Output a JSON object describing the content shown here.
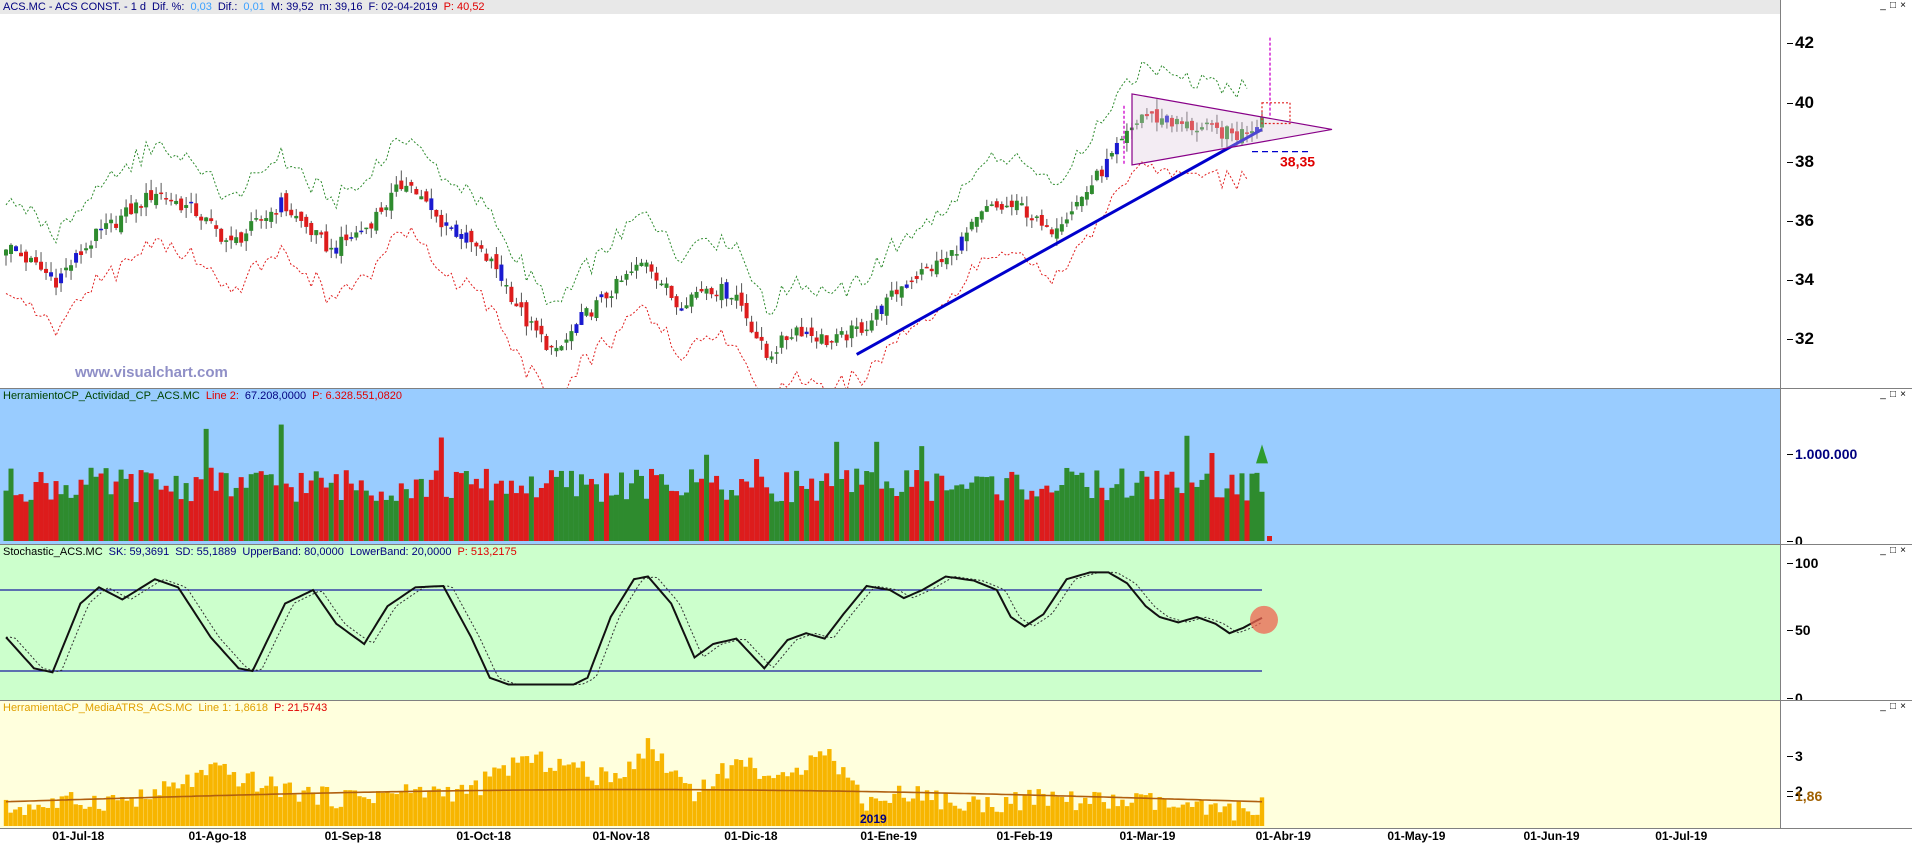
{
  "panes": {
    "price": {
      "header": [
        {
          "text": "ACS.MC - ACS CONST. -  1 d",
          "color": "#000080"
        },
        {
          "text": "Dif. %:",
          "color": "#000080"
        },
        {
          "text": "0,03",
          "color": "#3aa0ff"
        },
        {
          "text": "Dif.:",
          "color": "#000080"
        },
        {
          "text": "0,01",
          "color": "#3aa0ff"
        },
        {
          "text": "M: 39,52",
          "color": "#000080"
        },
        {
          "text": "m: 39,16",
          "color": "#000080"
        },
        {
          "text": "F: 02-04-2019",
          "color": "#000080"
        },
        {
          "text": "P: 40,52",
          "color": "#e00000"
        }
      ],
      "yticks": [
        "42",
        "40",
        "38",
        "36",
        "34",
        "32"
      ],
      "annotation": "38,35",
      "watermark": "www.visualchart.com"
    },
    "volume": {
      "header": [
        {
          "text": "HerramientoCP_Actividad_CP_ACS.MC",
          "color": "#004400"
        },
        {
          "text": "Line 2:",
          "color": "#e00000"
        },
        {
          "text": "67.208,0000",
          "color": "#000080"
        },
        {
          "text": "P: 6.328.551,0820",
          "color": "#e00000"
        }
      ],
      "yticks": [
        "1.000.000",
        "0"
      ]
    },
    "stochastic": {
      "header": [
        {
          "text": "Stochastic_ACS.MC",
          "color": "#000000"
        },
        {
          "text": "SK: 59,3691",
          "color": "#000080"
        },
        {
          "text": "SD: 55,1889",
          "color": "#000080"
        },
        {
          "text": "UpperBand: 80,0000",
          "color": "#000080"
        },
        {
          "text": "LowerBand: 20,0000",
          "color": "#000080"
        },
        {
          "text": "P: 513,2175",
          "color": "#e00000"
        }
      ],
      "yticks": [
        "100",
        "50",
        "0"
      ]
    },
    "atr": {
      "header": [
        {
          "text": "HerramientaCP_MediaATRS_ACS.MC",
          "color": "#e0a000"
        },
        {
          "text": "Line 1: 1,8618",
          "color": "#e0a000"
        },
        {
          "text": "P: 21,5743",
          "color": "#e00000"
        }
      ],
      "yticks": [
        "3",
        "2",
        "1,86"
      ],
      "year_label": "2019"
    }
  },
  "x_axis": {
    "labels": [
      "01-Jul-18",
      "01-Ago-18",
      "01-Sep-18",
      "01-Oct-18",
      "01-Nov-18",
      "01-Dic-18",
      "01-Ene-19",
      "01-Feb-19",
      "01-Mar-19",
      "01-Abr-19",
      "01-May-19",
      "01-Jun-19",
      "01-Jul-19"
    ]
  },
  "window_controls": [
    "_",
    "□",
    "×"
  ],
  "colors": {
    "up": "#2e8b2e",
    "down": "#dd1c1c",
    "neutral": "#1a1ad0",
    "volume_bg": "#99ccff",
    "stoch_bg": "#ccffcc",
    "atr_bg": "#ffffdd",
    "atr_bar": "#f7b500",
    "trendline": "#0000cc",
    "triangle": "#880088"
  },
  "chart_data": [
    {
      "type": "candlestick",
      "title": "ACS.MC - ACS CONST. - 1 d",
      "ylim": [
        30.5,
        43
      ],
      "x_start": "2018-06-20",
      "x_end": "2019-04-02",
      "trend_start": 31.5,
      "trend_end": 39.1,
      "channel_offset": 1.4,
      "triangle": {
        "top_left": 40.3,
        "bottom_left": 37.9,
        "apex": 39.1,
        "upper_right": 39.5
      },
      "target": 38.35,
      "close": 39.52,
      "anchors": [
        [
          0,
          35.2
        ],
        [
          10,
          34.0
        ],
        [
          18,
          35.5
        ],
        [
          30,
          37.0
        ],
        [
          38,
          36.3
        ],
        [
          45,
          35.2
        ],
        [
          55,
          36.6
        ],
        [
          65,
          35.0
        ],
        [
          72,
          35.8
        ],
        [
          80,
          37.4
        ],
        [
          86,
          36.1
        ],
        [
          92,
          35.4
        ],
        [
          98,
          34.4
        ],
        [
          104,
          32.6
        ],
        [
          110,
          31.5
        ],
        [
          115,
          32.7
        ],
        [
          122,
          33.8
        ],
        [
          128,
          34.7
        ],
        [
          134,
          33.2
        ],
        [
          140,
          33.8
        ],
        [
          146,
          33.5
        ],
        [
          152,
          31.4
        ],
        [
          158,
          32.4
        ],
        [
          165,
          31.9
        ],
        [
          172,
          32.5
        ],
        [
          180,
          34.0
        ],
        [
          188,
          34.7
        ],
        [
          196,
          36.4
        ],
        [
          203,
          36.5
        ],
        [
          208,
          35.6
        ],
        [
          215,
          36.8
        ],
        [
          222,
          38.4
        ],
        [
          227,
          39.6
        ],
        [
          234,
          39.3
        ],
        [
          240,
          39.1
        ],
        [
          246,
          38.9
        ],
        [
          250,
          39.3
        ],
        [
          251,
          39.52
        ]
      ]
    },
    {
      "type": "bar",
      "title": "HerramientoCP_Actividad_CP_ACS.MC",
      "ylim": [
        0,
        1600000
      ],
      "tick_value": 1000000,
      "typical_min": 450000,
      "typical_max": 850000,
      "spikes": [
        [
          40,
          1300000
        ],
        [
          55,
          1350000
        ],
        [
          87,
          1200000
        ],
        [
          140,
          1000000
        ],
        [
          150,
          950000
        ],
        [
          166,
          1150000
        ],
        [
          174,
          1150000
        ],
        [
          183,
          1100000
        ],
        [
          236,
          1220000
        ],
        [
          241,
          1020000
        ],
        [
          250,
          790000
        ]
      ]
    },
    {
      "type": "line",
      "title": "Stochastic_ACS.MC",
      "ylim": [
        0,
        100
      ],
      "upper_band": 80,
      "lower_band": 20,
      "last_SK": 59.3691,
      "last_SD": 55.1889,
      "anchors": [
        [
          0,
          45
        ],
        [
          6,
          22
        ],
        [
          10,
          19
        ],
        [
          16,
          70
        ],
        [
          20,
          82
        ],
        [
          25,
          73
        ],
        [
          32,
          88
        ],
        [
          37,
          82
        ],
        [
          44,
          45
        ],
        [
          50,
          22
        ],
        [
          53,
          20
        ],
        [
          60,
          70
        ],
        [
          66,
          80
        ],
        [
          71,
          55
        ],
        [
          77,
          40
        ],
        [
          82,
          68
        ],
        [
          88,
          82
        ],
        [
          94,
          83
        ],
        [
          100,
          45
        ],
        [
          104,
          15
        ],
        [
          108,
          10
        ],
        [
          116,
          10
        ],
        [
          122,
          10
        ],
        [
          125,
          15
        ],
        [
          130,
          60
        ],
        [
          135,
          88
        ],
        [
          138,
          90
        ],
        [
          143,
          70
        ],
        [
          148,
          30
        ],
        [
          152,
          40
        ],
        [
          157,
          44
        ],
        [
          163,
          22
        ],
        [
          168,
          43
        ],
        [
          172,
          48
        ],
        [
          176,
          44
        ],
        [
          180,
          62
        ],
        [
          185,
          83
        ],
        [
          190,
          80
        ],
        [
          193,
          74
        ],
        [
          197,
          80
        ],
        [
          202,
          90
        ],
        [
          208,
          87
        ],
        [
          213,
          80
        ],
        [
          216,
          60
        ],
        [
          219,
          53
        ],
        [
          223,
          62
        ],
        [
          228,
          88
        ],
        [
          233,
          93
        ],
        [
          237,
          93
        ],
        [
          241,
          85
        ],
        [
          245,
          68
        ],
        [
          248,
          60
        ],
        [
          252,
          56
        ],
        [
          256,
          60
        ],
        [
          260,
          55
        ],
        [
          263,
          48
        ],
        [
          266,
          52
        ],
        [
          270,
          59.37
        ]
      ]
    },
    {
      "type": "bar",
      "title": "HerramientaCP_MediaATRS_ACS.MC",
      "ylim": [
        1,
        4.2
      ],
      "average": 1.8618,
      "anchors": [
        [
          0,
          1.5
        ],
        [
          15,
          1.7
        ],
        [
          30,
          1.8
        ],
        [
          45,
          2.6
        ],
        [
          55,
          2.2
        ],
        [
          70,
          1.8
        ],
        [
          88,
          2.0
        ],
        [
          100,
          2.0
        ],
        [
          110,
          2.9
        ],
        [
          120,
          2.8
        ],
        [
          130,
          2.3
        ],
        [
          138,
          3.3
        ],
        [
          148,
          2.0
        ],
        [
          158,
          2.9
        ],
        [
          168,
          2.2
        ],
        [
          175,
          3.4
        ],
        [
          185,
          1.7
        ],
        [
          195,
          2.0
        ],
        [
          205,
          1.6
        ],
        [
          215,
          1.7
        ],
        [
          225,
          1.8
        ],
        [
          235,
          1.7
        ],
        [
          245,
          1.7
        ],
        [
          255,
          1.5
        ],
        [
          262,
          1.4
        ],
        [
          270,
          1.6
        ]
      ]
    }
  ]
}
